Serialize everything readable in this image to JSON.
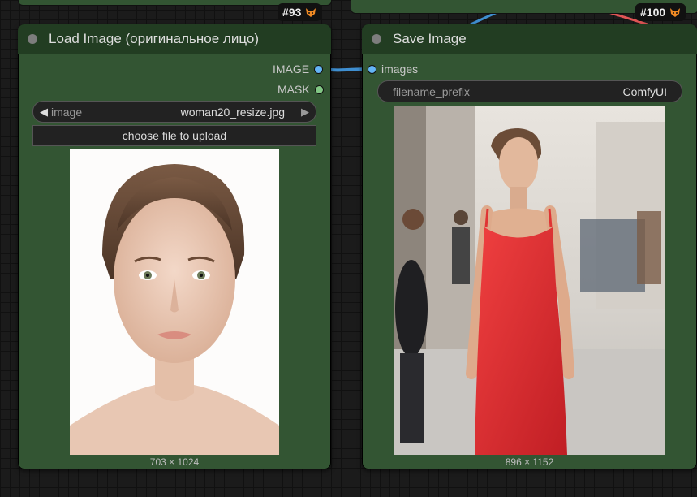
{
  "canvas": {
    "background": "#1b1b1b",
    "node_color": "#335533",
    "header_color": "#223d22"
  },
  "nodes": {
    "load_image": {
      "id_badge": "#93",
      "title": "Load Image (оригинальное лицо)",
      "outputs": [
        {
          "label": "IMAGE",
          "color": "#64b5f6"
        },
        {
          "label": "MASK",
          "color": "#81c784"
        }
      ],
      "image_widget": {
        "name": "image",
        "value": "woman20_resize.jpg"
      },
      "upload_button": "choose file to upload",
      "preview_size": "703 × 1024"
    },
    "save_image": {
      "id_badge": "#100",
      "title": "Save Image",
      "inputs": [
        {
          "label": "images",
          "color": "#64b5f6"
        }
      ],
      "filename_prefix": {
        "name": "filename_prefix",
        "value": "ComfyUI"
      },
      "preview_size": "896 × 1152"
    }
  }
}
